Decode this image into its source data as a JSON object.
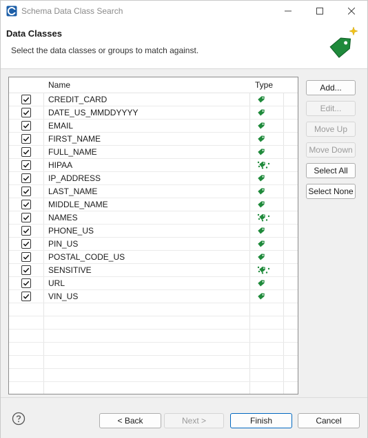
{
  "window": {
    "title": "Schema Data Class Search"
  },
  "header": {
    "title": "Data Classes",
    "description": "Select the data classes or groups to match against."
  },
  "table": {
    "columns": {
      "name": "Name",
      "type": "Type"
    },
    "rows": [
      {
        "name": "CREDIT_CARD",
        "checked": true,
        "type_icon": "tag-icon"
      },
      {
        "name": "DATE_US_MMDDYYYY",
        "checked": true,
        "type_icon": "tag-icon"
      },
      {
        "name": "EMAIL",
        "checked": true,
        "type_icon": "tag-icon"
      },
      {
        "name": "FIRST_NAME",
        "checked": true,
        "type_icon": "tag-icon"
      },
      {
        "name": "FULL_NAME",
        "checked": true,
        "type_icon": "tag-icon"
      },
      {
        "name": "HIPAA",
        "checked": true,
        "type_icon": "tag-group-icon"
      },
      {
        "name": "IP_ADDRESS",
        "checked": true,
        "type_icon": "tag-icon"
      },
      {
        "name": "LAST_NAME",
        "checked": true,
        "type_icon": "tag-icon"
      },
      {
        "name": "MIDDLE_NAME",
        "checked": true,
        "type_icon": "tag-icon"
      },
      {
        "name": "NAMES",
        "checked": true,
        "type_icon": "tag-group-icon"
      },
      {
        "name": "PHONE_US",
        "checked": true,
        "type_icon": "tag-icon"
      },
      {
        "name": "PIN_US",
        "checked": true,
        "type_icon": "tag-icon"
      },
      {
        "name": "POSTAL_CODE_US",
        "checked": true,
        "type_icon": "tag-icon"
      },
      {
        "name": "SENSITIVE",
        "checked": true,
        "type_icon": "tag-group-icon"
      },
      {
        "name": "URL",
        "checked": true,
        "type_icon": "tag-icon"
      },
      {
        "name": "VIN_US",
        "checked": true,
        "type_icon": "tag-icon"
      }
    ]
  },
  "side_buttons": {
    "add": "Add...",
    "edit": "Edit...",
    "move_up": "Move Up",
    "move_down": "Move Down",
    "select_all": "Select All",
    "select_none": "Select None"
  },
  "footer": {
    "back": "< Back",
    "next": "Next >",
    "finish": "Finish",
    "cancel": "Cancel"
  },
  "colors": {
    "tag_green": "#1f8a3b",
    "accent_blue": "#0067c0"
  }
}
